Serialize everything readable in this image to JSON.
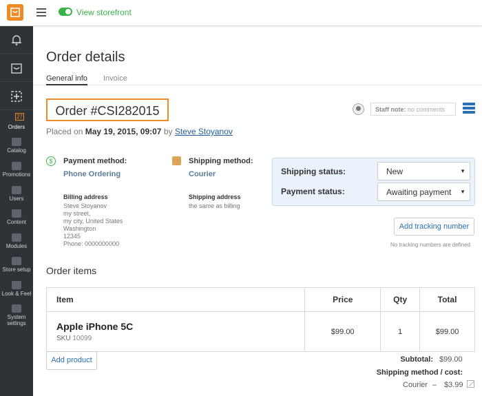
{
  "topbar": {
    "view_storefront": "View storefront"
  },
  "sidebar": {
    "orders_badge": "27",
    "items": [
      {
        "label": "Orders"
      },
      {
        "label": "Catalog"
      },
      {
        "label": "Promotions"
      },
      {
        "label": "Users"
      },
      {
        "label": "Content"
      },
      {
        "label": "Modules"
      },
      {
        "label": "Store setup"
      },
      {
        "label": "Look & Feel"
      },
      {
        "label": "System settings"
      }
    ]
  },
  "page": {
    "title": "Order details",
    "tabs": [
      {
        "label": "General info",
        "active": true
      },
      {
        "label": "Invoice",
        "active": false
      }
    ]
  },
  "order": {
    "title": "Order #CSI282015",
    "placed_prefix": "Placed on",
    "placed_date": "May 19, 2015, 09:07",
    "placed_by": "by",
    "customer": "Steve Stoyanov"
  },
  "staff_note": {
    "label": "Staff note:",
    "value": "no comments"
  },
  "payment": {
    "label": "Payment method:",
    "value": "Phone Ordering"
  },
  "shipping": {
    "label": "Shipping method:",
    "value": "Courier"
  },
  "billing_address": {
    "title": "Billing address",
    "lines": [
      "Steve Stoyanov",
      "my street,",
      "my city, United States",
      "Washington",
      "12345",
      "Phone: 0000000000"
    ]
  },
  "shipping_address": {
    "title": "Shipping address",
    "value": "the same as billing"
  },
  "status": {
    "shipping_label": "Shipping status:",
    "shipping_value": "New",
    "payment_label": "Payment status:",
    "payment_value": "Awaiting payment"
  },
  "tracking": {
    "button": "Add tracking number",
    "note": "No tracking numbers are defined"
  },
  "items": {
    "title": "Order items",
    "headers": {
      "item": "Item",
      "price": "Price",
      "qty": "Qty",
      "total": "Total"
    },
    "rows": [
      {
        "name": "Apple iPhone 5C",
        "sku_label": "SKU",
        "sku": "10099",
        "price": "$99.00",
        "qty": "1",
        "total": "$99.00"
      }
    ],
    "add_product": "Add product"
  },
  "totals": {
    "subtotal_label": "Subtotal:",
    "subtotal_value": "$99.00",
    "shipping_label": "Shipping method / cost:",
    "shipping_method": "Courier",
    "shipping_sep": "–",
    "shipping_cost": "$3.99"
  },
  "colors": {
    "accent": "#f08a24",
    "green": "#3bb34a",
    "link": "#2a6fb5",
    "sidebar": "#2e3338"
  }
}
